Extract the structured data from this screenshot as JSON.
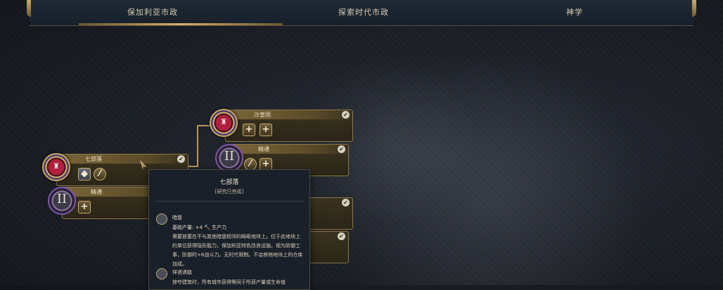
{
  "tabs": [
    "保加利亚市政",
    "探索时代市政",
    "神学"
  ],
  "nodes": {
    "seven_tribes": {
      "title": "七部落"
    },
    "mastery_left": {
      "title": "精通"
    },
    "shahuang": {
      "title": "沙皇国"
    },
    "mastery_mid": {
      "title": "精通"
    }
  },
  "tooltip": {
    "title": "七部落",
    "status": "[研究已完成]",
    "item1_name": "暗堡",
    "item1_yield": "基础产量: +4 🔨 生产力",
    "item1_desc": "需要放置在不与其他暗堡相邻的崎岖地块上。位于此地块上的单位获得隐形能力。保加利亚特色改良设施。视为防御工事，防御时+6战斗力。无时代限制。不会移除地块上的仓库加成。",
    "item2_name": "佯退诱敌",
    "item2_desc": "掠夺建筑时，所有城市获得等同于所获产量或生命值"
  },
  "colors": {
    "accent": "#c9a766",
    "medal_red": "#b0203c",
    "tooltip_bg": "#1a2029"
  }
}
